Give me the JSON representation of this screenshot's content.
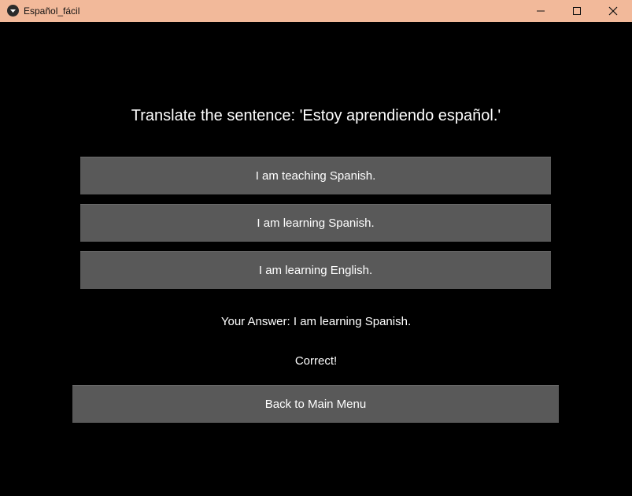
{
  "window": {
    "title": "Español_fácil",
    "titlebar_color": "#f2b99a"
  },
  "quiz": {
    "question": "Translate the sentence: 'Estoy aprendiendo español.'",
    "options": [
      "I am teaching Spanish.",
      "I am learning Spanish.",
      "I am learning English."
    ],
    "your_answer": "Your Answer: I am learning Spanish.",
    "result": "Correct!",
    "back_label": "Back to Main Menu"
  },
  "colors": {
    "background": "#000000",
    "button": "#595959",
    "text": "#ffffff"
  }
}
